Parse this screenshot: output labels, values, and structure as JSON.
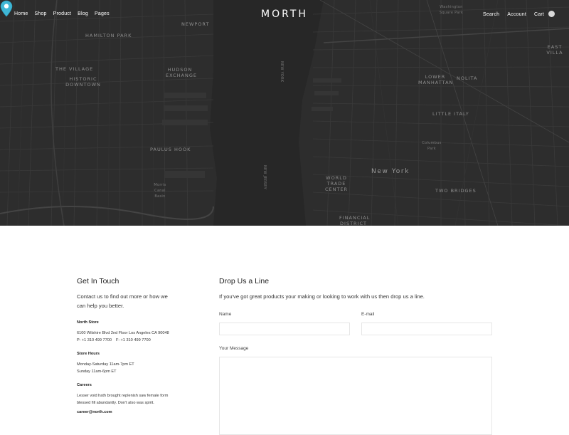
{
  "nav": {
    "items": [
      "Home",
      "Shop",
      "Product",
      "Blog",
      "Pages"
    ],
    "logo": "MORTH",
    "right": {
      "search": "Search",
      "account": "Account",
      "cart": "Cart"
    }
  },
  "map": {
    "labels": {
      "hamilton_park": "HAMILTON PARK",
      "newport": "NEWPORT",
      "the_village": "THE VILLAGE",
      "historic_downtown": "HISTORIC DOWNTOWN",
      "hudson_exchange": "HUDSON EXCHANGE",
      "paulus_hook": "PAULUS HOOK",
      "new_york_ave": "NEW YORK",
      "new_jersey": "NEW JERSEY",
      "lower_manhattan": "LOWER MANHATTAN",
      "nolita": "NOLITA",
      "little_italy": "LITTLE ITALY",
      "east_village": "EAST VILLA",
      "washington_square_park": "Washington Square Park",
      "new_york": "New York",
      "world_trade_center": "WORLD TRADE CENTER",
      "two_bridges": "TWO BRIDGES",
      "financial_district": "FINANCIAL DISTRICT",
      "morris_canal": "Morris Canal Basin",
      "columbus_park": "Columbus Park"
    },
    "pin_color": "#3fb7d6"
  },
  "contact": {
    "title": "Get In Touch",
    "lead": "Contact us to find out more or how we can help you better.",
    "store_title": "North Store",
    "store_address": "6100 Wilshire Blvd 2nd Floor Los Angeles CA 90048",
    "phone": "P: +1 310 499 7700",
    "fax": "F: +1 310 499 7700",
    "hours_title": "Store Hours",
    "hours_weekday": "Monday-Saturday 11am-7pm ET",
    "hours_sunday": "Sunday 11am-6pm ET",
    "careers_title": "Careers",
    "careers_text": "Lesser void hath brought replenish saw female form blessed fill abundantly. Don't also was spirit.",
    "careers_email": "career@north.com"
  },
  "form": {
    "title": "Drop Us a Line",
    "lead": "If you've got great products your making or looking to work with us then drop us a line.",
    "name_label": "Name",
    "email_label": "E-mail",
    "message_label": "Your Message",
    "name_value": "",
    "email_value": "",
    "message_value": ""
  }
}
